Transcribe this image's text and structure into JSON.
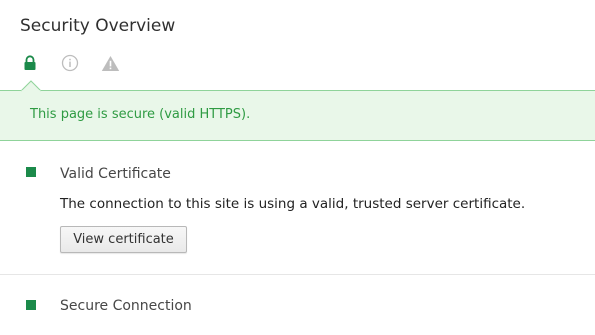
{
  "page": {
    "title": "Security Overview"
  },
  "icons": {
    "lock": "lock-icon",
    "info": "info-icon",
    "warning": "warning-icon"
  },
  "banner": {
    "text": "This page is secure (valid HTTPS)."
  },
  "sections": [
    {
      "title": "Valid Certificate",
      "description": "The connection to this site is using a valid, trusted server certificate.",
      "button_label": "View certificate",
      "status": "secure"
    },
    {
      "title": "Secure Connection",
      "status": "secure"
    }
  ],
  "colors": {
    "secure_green": "#1b8a4a",
    "banner_bg": "#e9f7e9",
    "banner_text": "#2f9b43",
    "banner_border": "#8fd39a",
    "inactive_icon": "#bdbdbd"
  }
}
